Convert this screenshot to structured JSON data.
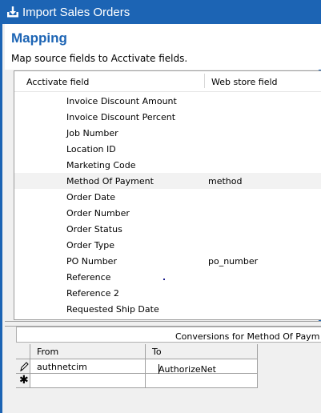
{
  "window": {
    "title": "Import Sales Orders",
    "title_icon": "import-download-icon",
    "accent_color": "#1c64b4"
  },
  "header": {
    "title": "Mapping",
    "subtitle": "Map source fields to Acctivate fields."
  },
  "mapping_grid": {
    "columns": [
      "Acctivate field",
      "Web store field"
    ],
    "rows": [
      {
        "acctivate": "Invoice Discount Amount",
        "webstore": ""
      },
      {
        "acctivate": "Invoice Discount Percent",
        "webstore": ""
      },
      {
        "acctivate": "Job Number",
        "webstore": ""
      },
      {
        "acctivate": "Location ID",
        "webstore": ""
      },
      {
        "acctivate": "Marketing Code",
        "webstore": ""
      },
      {
        "acctivate": "Method Of Payment",
        "webstore": "method",
        "selected": true
      },
      {
        "acctivate": "Order Date",
        "webstore": ""
      },
      {
        "acctivate": "Order Number",
        "webstore": ""
      },
      {
        "acctivate": "Order Status",
        "webstore": ""
      },
      {
        "acctivate": "Order Type",
        "webstore": ""
      },
      {
        "acctivate": "PO Number",
        "webstore": "po_number"
      },
      {
        "acctivate": "Reference",
        "webstore": ""
      },
      {
        "acctivate": "Reference 2",
        "webstore": ""
      },
      {
        "acctivate": "Requested Ship Date",
        "webstore": ""
      }
    ]
  },
  "conversions": {
    "caption": "Conversions for Method Of Paym",
    "columns": [
      "From",
      "To"
    ],
    "rows": [
      {
        "from": "authnetcim",
        "to": "AuthorizeNet",
        "indicator": "pencil-edit-icon"
      },
      {
        "from": "",
        "to": "",
        "indicator": "new-row-asterisk-icon"
      }
    ]
  }
}
